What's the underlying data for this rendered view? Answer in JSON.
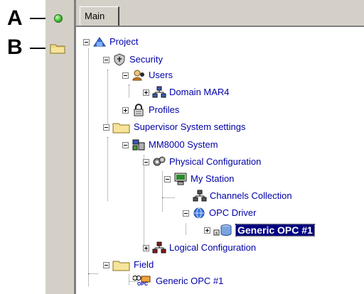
{
  "callouts": [
    {
      "letter": "A",
      "icon": "green-status-dot"
    },
    {
      "letter": "B",
      "icon": "folder-icon"
    }
  ],
  "tabs": [
    {
      "label": "Main"
    }
  ],
  "tree": {
    "project": "Project",
    "security": "Security",
    "users": "Users",
    "domain": "Domain MAR4",
    "profiles": "Profiles",
    "supervisor": "Supervisor System settings",
    "mm8000": "MM8000 System",
    "physical": "Physical Configuration",
    "station": "My Station",
    "channels": "Channels Collection",
    "opc_driver": "OPC Driver",
    "generic_sel": "Generic OPC #1",
    "logical": "Logical Configuration",
    "field": "Field",
    "generic_field": "Generic OPC #1",
    "opc_badge": "OPC"
  },
  "colors": {
    "selection": "#000080",
    "link_text": "#0000a8",
    "chrome": "#d4d0c8"
  }
}
